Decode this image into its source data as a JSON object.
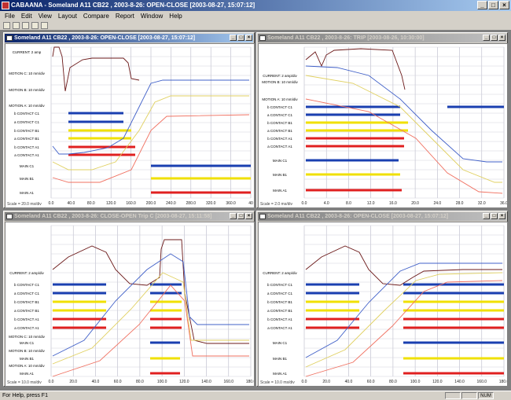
{
  "app": {
    "title": "CABAANA - Someland A11 CB22 , 2003-8-26: OPEN-CLOSE  [2003-08-27, 15:07:12]",
    "menu": [
      "File",
      "Edit",
      "View",
      "Layout",
      "Compare",
      "Report",
      "Window",
      "Help"
    ],
    "status_text": "For Help, press F1",
    "status_num": "NUM"
  },
  "colors": {
    "current": "#6b1818",
    "motion": "#2040c0",
    "contact_c": "#1a3fb0",
    "contact_b": "#f0e000",
    "contact_a": "#e02020",
    "title_active": "#0a246a"
  },
  "panels": [
    {
      "title": "Someland A11 CB22 , 2003-8-26: OPEN-CLOSE  [2003-08-27, 15:07:12]",
      "scale": "Scale = 20.0 ms/div",
      "x_ticks": [
        "0.0",
        "40.0",
        "80.0",
        "120.0",
        "160.0",
        "200.0",
        "240.0",
        "280.0",
        "320.0",
        "360.0",
        "40"
      ],
      "labels": [
        {
          "text": "CURRENT: 2 amp",
          "color": "#6b1818",
          "y": 10
        },
        {
          "text": "MOTION C: 10 mm/div",
          "color": "#2040c0",
          "y": 37
        },
        {
          "text": "MOTION B: 10 mm/div",
          "color": "#e8d000",
          "y": 58
        },
        {
          "text": "MOTION A: 10 mm/div",
          "color": "#e02020",
          "y": 78
        },
        {
          "text": "b CONTACT C1",
          "color": "#1a3fb0",
          "y": 88
        },
        {
          "text": "a CONTACT C1",
          "color": "#1a3fb0",
          "y": 99
        },
        {
          "text": "b CONTACT B1",
          "color": "#e8d000",
          "y": 110
        },
        {
          "text": "a CONTACT B1",
          "color": "#e8d000",
          "y": 120
        },
        {
          "text": "b CONTACT A1",
          "color": "#e02020",
          "y": 131
        },
        {
          "text": "a CONTACT A1",
          "color": "#e02020",
          "y": 141
        },
        {
          "text": "MAIN C1",
          "color": "#1a3fb0",
          "y": 155
        },
        {
          "text": "MAIN B1",
          "color": "#e8d000",
          "y": 171
        },
        {
          "text": "MAIN A1",
          "color": "#e02020",
          "y": 189
        }
      ]
    },
    {
      "title": "Someland A11 CB22 , 2003-8-26: TRIP  [2003-08-26, 10:30:00]",
      "scale": "Scale = 2.0 ms/div",
      "x_ticks": [
        "0.0",
        "4.0",
        "8.0",
        "12.0",
        "16.0",
        "20.0",
        "24.0",
        "28.0",
        "32.0",
        "36.0"
      ],
      "labels": [
        {
          "text": "CURRENT: 2 amp/div",
          "color": "#6b1818",
          "y": 40
        },
        {
          "text": "MOTION B: 10 mm/div",
          "color": "#e8d000",
          "y": 48
        },
        {
          "text": "MOTION A: 10 mm/div",
          "color": "#e02020",
          "y": 70
        },
        {
          "text": "b CONTACT C1",
          "color": "#1a3fb0",
          "y": 80
        },
        {
          "text": "a CONTACT C1",
          "color": "#1a3fb0",
          "y": 90
        },
        {
          "text": "b CONTACT B1",
          "color": "#e8d000",
          "y": 100
        },
        {
          "text": "a CONTACT B1",
          "color": "#e8d000",
          "y": 110
        },
        {
          "text": "b CONTACT A1",
          "color": "#e02020",
          "y": 120
        },
        {
          "text": "a CONTACT A1",
          "color": "#e02020",
          "y": 130
        },
        {
          "text": "MAIN C1",
          "color": "#1a3fb0",
          "y": 148
        },
        {
          "text": "MAIN B1",
          "color": "#e8d000",
          "y": 166
        },
        {
          "text": "MAIN A1",
          "color": "#e02020",
          "y": 186
        }
      ]
    },
    {
      "title": "Someland A11 CB22 , 2003-8-26: CLOSE-OPEN Trip C  [2003-08-27, 15:11:58]",
      "scale": "Scale = 10.0 ms/div",
      "x_ticks": [
        "0.0",
        "20.0",
        "40.0",
        "60.0",
        "80.0",
        "100.0",
        "120.0",
        "140.0",
        "160.0",
        "180.0"
      ],
      "labels": [
        {
          "text": "CURRENT: 2 amp/div",
          "color": "#6b1818",
          "y": 64
        },
        {
          "text": "b CONTACT C1",
          "color": "#1a3fb0",
          "y": 79
        },
        {
          "text": "a CONTACT C1",
          "color": "#1a3fb0",
          "y": 90
        },
        {
          "text": "b CONTACT B1",
          "color": "#e8d000",
          "y": 101
        },
        {
          "text": "a CONTACT B1",
          "color": "#e8d000",
          "y": 112
        },
        {
          "text": "b CONTACT A1",
          "color": "#e02020",
          "y": 123
        },
        {
          "text": "a CONTACT A1",
          "color": "#e02020",
          "y": 134
        },
        {
          "text": "MOTION C: 10 mm/div",
          "color": "#2040c0",
          "y": 145
        },
        {
          "text": "MAIN C1",
          "color": "#1a3fb0",
          "y": 153
        },
        {
          "text": "MOTION B: 10 mm/div",
          "color": "#e8d000",
          "y": 163
        },
        {
          "text": "MAIN B1",
          "color": "#e8d000",
          "y": 173
        },
        {
          "text": "MOTION A: 10 mm/div",
          "color": "#e02020",
          "y": 182
        },
        {
          "text": "MAIN A1",
          "color": "#e02020",
          "y": 192
        }
      ]
    },
    {
      "title": "Someland A11 CB22 , 2003-8-26: OPEN-CLOSE  [2003-08-27, 15:07:12]",
      "scale": "Scale = 10.0 ms/div",
      "x_ticks": [
        "0.0",
        "20.0",
        "40.0",
        "60.0",
        "80.0",
        "100.0",
        "120.0",
        "140.0",
        "160.0",
        "180.0"
      ],
      "labels": [
        {
          "text": "CURRENT: 2 amp/div",
          "color": "#6b1818",
          "y": 64
        },
        {
          "text": "b CONTACT C1",
          "color": "#1a3fb0",
          "y": 79
        },
        {
          "text": "a CONTACT C1",
          "color": "#1a3fb0",
          "y": 90
        },
        {
          "text": "b CONTACT B1",
          "color": "#e8d000",
          "y": 101
        },
        {
          "text": "a CONTACT B1",
          "color": "#e8d000",
          "y": 112
        },
        {
          "text": "b CONTACT A1",
          "color": "#e02020",
          "y": 123
        },
        {
          "text": "a CONTACT A1",
          "color": "#e02020",
          "y": 134
        },
        {
          "text": "MAIN C1",
          "color": "#1a3fb0",
          "y": 153
        },
        {
          "text": "MAIN B1",
          "color": "#e8d000",
          "y": 173
        },
        {
          "text": "MAIN A1",
          "color": "#e02020",
          "y": 192
        }
      ]
    }
  ]
}
